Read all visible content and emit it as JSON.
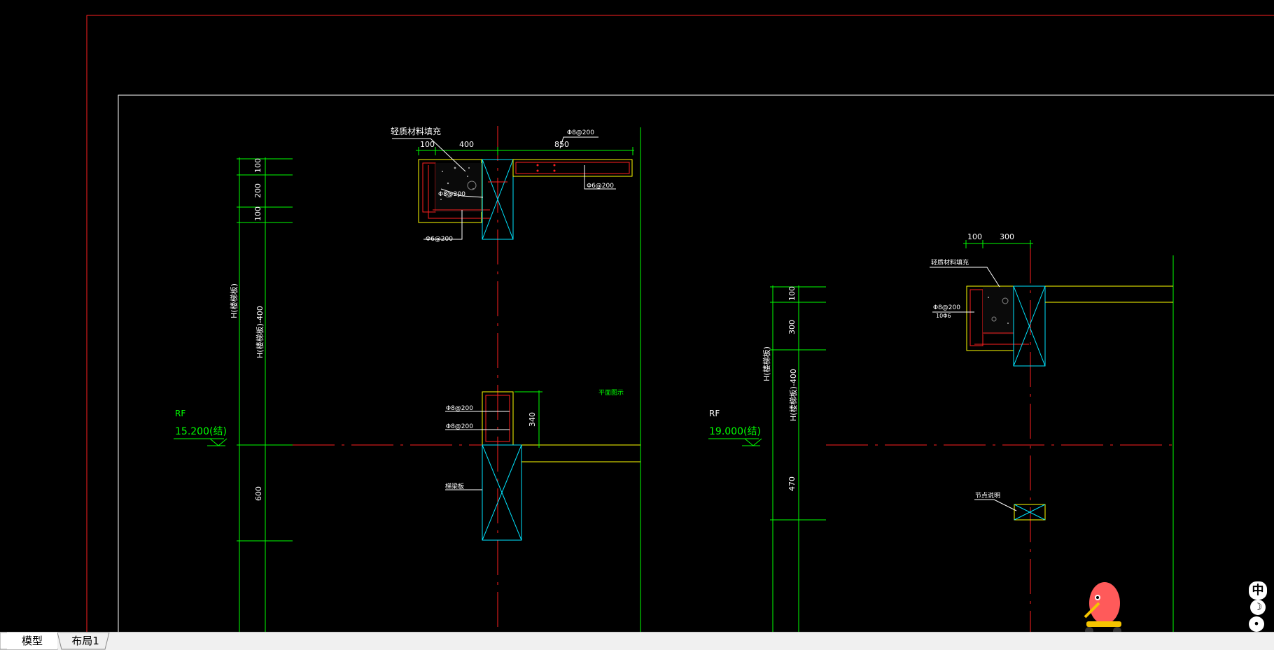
{
  "tabs": [
    {
      "label": "模型",
      "active": true
    },
    {
      "label": "布局1",
      "active": false
    }
  ],
  "left_detail": {
    "fill_label": "轻质材料填充",
    "top_dims": [
      "100",
      "400",
      "850"
    ],
    "rebar_top_right": "Φ8@200",
    "rebar_right_slab": "Φ6@200",
    "rebar_inner": "Φ8@200",
    "rebar_bottom": "Φ6@200",
    "vert_dims_top": [
      "100",
      "200",
      "100"
    ],
    "height_labels": [
      "H(楼梯板)",
      "H(楼梯板)-400"
    ],
    "rebar_mid_1": "Φ8@200",
    "rebar_mid_2": "Φ8@200",
    "dim_340": "340",
    "beam_label": "梯梁板",
    "note_green": "平面图示",
    "dim_600": "600",
    "level_name": "RF",
    "level_value": "15.200(结)"
  },
  "right_detail": {
    "top_dims": [
      "100",
      "300"
    ],
    "fill_label": "轻质材料填充",
    "rebar_label": "Φ8@200",
    "rebar_sub": "10Φ6",
    "vert_dims": [
      "100",
      "300"
    ],
    "height_labels": [
      "H(楼梯板)",
      "H(楼梯板)-400"
    ],
    "dim_470": "470",
    "node_label": "节点说明",
    "level_name": "RF",
    "level_value": "19.000(结)"
  },
  "ime": {
    "label": "中",
    "moon": "☽",
    "dot": "•",
    "shirt": "👕"
  },
  "colors": {
    "border_red": "#ff2020",
    "frame_white": "#ffffff",
    "green": "#00ff00",
    "yellow": "#ffff00",
    "cyan": "#00e5ff",
    "red": "#ff2020"
  }
}
